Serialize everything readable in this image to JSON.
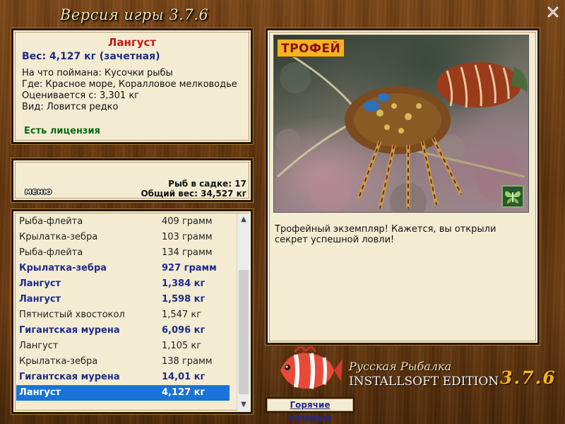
{
  "window": {
    "title": "Версия игры 3.7.6",
    "close_icon": "close-icon"
  },
  "info": {
    "name": "Лангуст",
    "weight": "Вес: 4,127 кг (зачетная)",
    "bait": "На что поймана: Кусочки рыбы",
    "location": "Где: Красное море, Коралловое мелководье",
    "rating": "Оценивается с: 3,301 кг",
    "kind": "Вид: Ловится редко",
    "license": "Есть лицензия"
  },
  "keep": {
    "menu_label": "МЕНЮ",
    "fish_count": "Рыб в садке: 17",
    "total_weight": "Общий вес: 34,527 кг"
  },
  "catch_list": [
    {
      "name": "Рыба-флейта",
      "weight": "409 грамм",
      "trophy": false
    },
    {
      "name": "Крылатка-зебра",
      "weight": "103 грамм",
      "trophy": false
    },
    {
      "name": "Рыба-флейта",
      "weight": "134 грамм",
      "trophy": false
    },
    {
      "name": "Крылатка-зебра",
      "weight": "927 грамм",
      "trophy": true
    },
    {
      "name": "Лангуст",
      "weight": "1,384 кг",
      "trophy": true
    },
    {
      "name": "Лангуст",
      "weight": "1,598 кг",
      "trophy": true
    },
    {
      "name": "Пятнистый хвостокол",
      "weight": "1,547 кг",
      "trophy": false
    },
    {
      "name": "Гигантская мурена",
      "weight": "6,096 кг",
      "trophy": true
    },
    {
      "name": "Лангуст",
      "weight": "1,105 кг",
      "trophy": false
    },
    {
      "name": "Крылатка-зебра",
      "weight": "138 грамм",
      "trophy": false
    },
    {
      "name": "Гигантская мурена",
      "weight": "14,01 кг",
      "trophy": true
    },
    {
      "name": "Лангуст",
      "weight": "4,127 кг",
      "trophy": true,
      "selected": true
    }
  ],
  "scroll": {
    "up_icon": "▲",
    "down_icon": "▼"
  },
  "detail": {
    "trophy_badge": "ТРОФЕЙ",
    "description": "Трофейный экземпляр! Кажется, вы открыли секрет успешной ловли!",
    "butterfly_icon": "butterfly-icon"
  },
  "brand": {
    "title": "Русская Рыбалка",
    "edition": "INSTALLSOFT EDITION",
    "version": "3.7.6"
  },
  "hotkeys_label": "Горячие клавиши",
  "colors": {
    "trophy_text": "#1e2b8a",
    "selected_row": "#1a73d6",
    "fish_name": "#c01818",
    "license": "#0a6a12",
    "badge": "#f2b320"
  }
}
